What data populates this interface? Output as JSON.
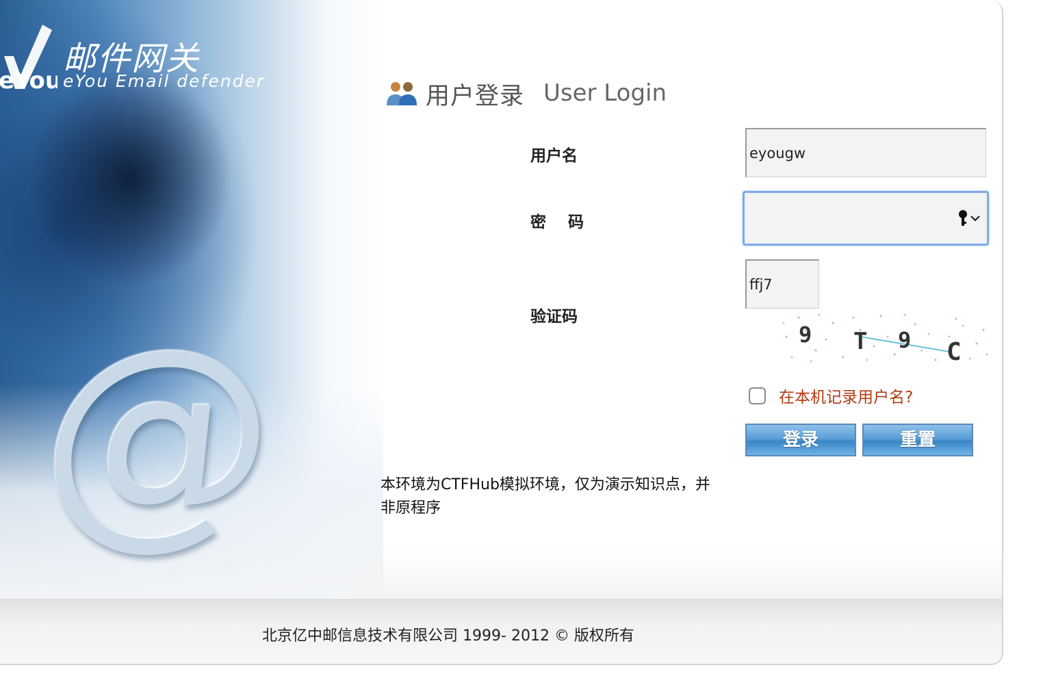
{
  "brand": {
    "logo_mark": "eYou",
    "name_cn": "邮件网关",
    "name_en": "eYou Email defender"
  },
  "heading": {
    "title_cn": "用户登录",
    "title_en": "User Login",
    "icon": "users-icon"
  },
  "form": {
    "username_label": "用户名",
    "username_value": "eyougw",
    "password_label": "密    码",
    "password_value": "",
    "password_icon": "key-icon",
    "captcha_label": "验证码",
    "captcha_value": "ffj7",
    "captcha_image_text": "9T9C",
    "remember_label": "在本机记录用户名?",
    "remember_checked": false,
    "login_button": "登录",
    "reset_button": "重置"
  },
  "notice": "本环境为CTFHub模拟环境，仅为演示知识点，并非原程序",
  "footer": {
    "copyright": "北京亿中邮信息技术有限公司   1999-  2012 © 版权所有"
  }
}
